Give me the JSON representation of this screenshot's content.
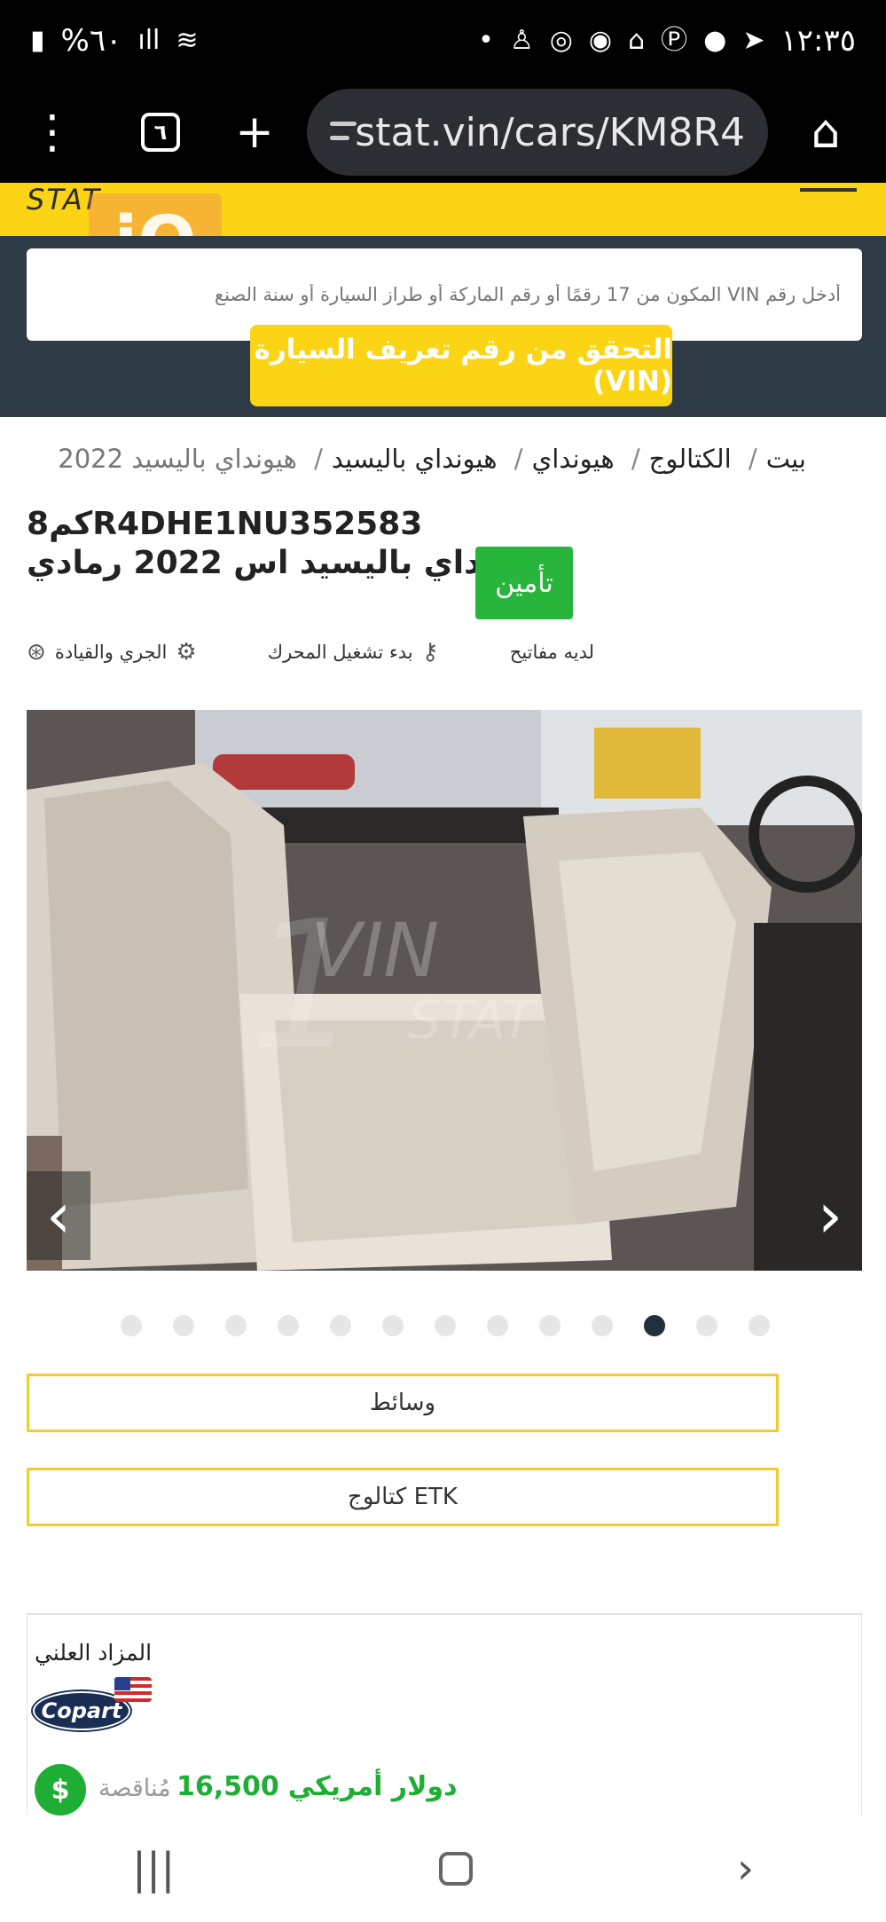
{
  "status_bar": {
    "time": "١٢:٣٥",
    "battery": "%٦٠",
    "left_icons": [
      "battery-icon",
      "signal-icon",
      "wifi-icon"
    ],
    "right_icons": [
      "dot-icon",
      "notification-icon",
      "spiral-icon",
      "target-icon",
      "home-alert-icon",
      "pinterest-icon",
      "chat-icon",
      "telegram-icon"
    ]
  },
  "browser": {
    "url": "stat.vin/cars/KM8R4",
    "tab_count": "٦"
  },
  "site": {
    "logo_text": "STAT",
    "watermark": "iQ",
    "accent_color": "#fbd415",
    "dark_color": "#2e3a45"
  },
  "search": {
    "placeholder": "أدخل رقم VIN المكون من 17 رقمًا أو رقم الماركة أو طراز السيارة أو سنة الصنع",
    "button_label": "التحقق من رقم تعريف السيارة (VIN)"
  },
  "breadcrumb": {
    "items": [
      "بيت",
      "الكتالوج",
      "هيونداي",
      "هيونداي باليسيد"
    ],
    "current": "هيونداي باليسيد 2022"
  },
  "vehicle": {
    "vin": "كم8R4DHE1NU352583",
    "title": "هيونداي باليسيد اس 2022 رمادي",
    "insurance_button": "تأمين"
  },
  "features": [
    {
      "label": "لديه مفاتيح",
      "icon": "key-icon"
    },
    {
      "label": "بدء تشغيل المحرك",
      "icon": "engine-icon"
    },
    {
      "label": "الجري والقيادة",
      "icon": "steering-wheel-icon"
    }
  ],
  "gallery": {
    "watermark_text": "VIN",
    "watermark_sub": "STAT",
    "watermark_num": "1",
    "total_images": 13,
    "active_index": 10
  },
  "buttons": {
    "media": "وسائط",
    "etk_catalog": "كتالوج ETK"
  },
  "auction": {
    "label": "المزاد العلني",
    "house": "Copart",
    "bid_type": "مُناقصة",
    "price": "16,500",
    "currency": "دولار أمريكي"
  }
}
